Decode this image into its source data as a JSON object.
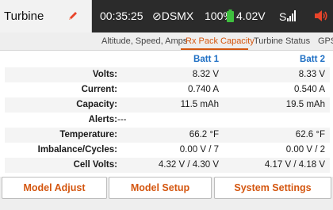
{
  "header": {
    "model_name": "Turbine",
    "timer": "00:35:25",
    "link": "⊘DSMX",
    "battery_percent": "100%",
    "battery_voltage": "4.02V",
    "signal_label": "S",
    "accent_color": "#d4560f",
    "battery_color": "#3fbf3f"
  },
  "tabs": [
    {
      "label": "Altitude, Speed, Amps",
      "active": false
    },
    {
      "label": "Rx Pack Capacity",
      "active": true
    },
    {
      "label": "Turbine Status",
      "active": false
    },
    {
      "label": "GPS",
      "active": false
    }
  ],
  "table": {
    "col1": "Batt 1",
    "col2": "Batt 2",
    "rows": [
      {
        "label": "Volts:",
        "v1": "8.32  V",
        "v2": "8.33  V"
      },
      {
        "label": "Current:",
        "v1": "0.740  A",
        "v2": "0.540  A"
      },
      {
        "label": "Capacity:",
        "v1": "11.5  mAh",
        "v2": "19.5  mAh"
      },
      {
        "label": "Alerts:",
        "v1": "---",
        "v2": ""
      },
      {
        "label": "Temperature:",
        "v1": "66.2  °F",
        "v2": "62.6  °F"
      },
      {
        "label": "Imbalance/Cycles:",
        "v1": "0.00 V / 7",
        "v2": "0.00 V / 2"
      },
      {
        "label": "Cell Volts:",
        "v1": "4.32 V / 4.30 V",
        "v2": "4.17 V / 4.18 V"
      }
    ]
  },
  "buttons": {
    "model_adjust": "Model Adjust",
    "model_setup": "Model Setup",
    "system_settings": "System Settings"
  }
}
